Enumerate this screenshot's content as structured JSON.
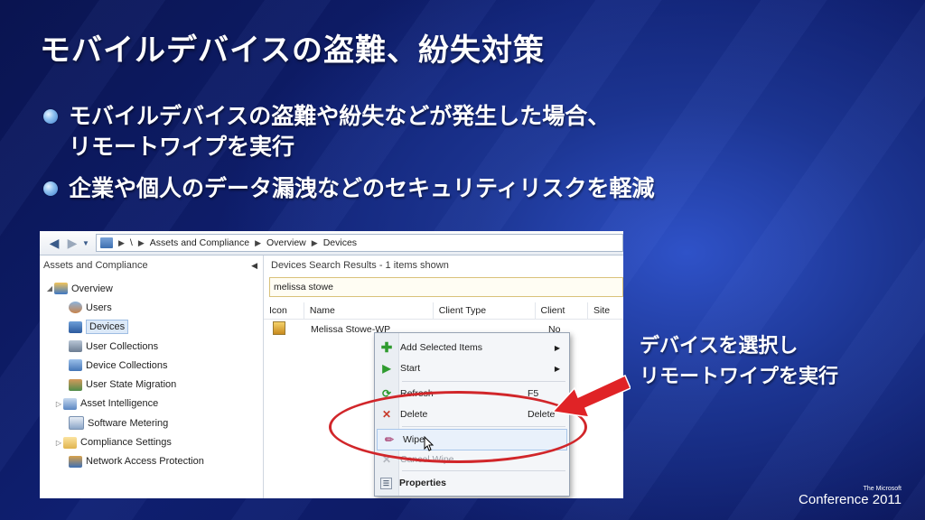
{
  "slide": {
    "title": "モバイルデバイスの盗難、紛失対策",
    "bullets": [
      {
        "line1": "モバイルデバイスの盗難や紛失などが発生した場合、",
        "line2": "リモートワイプを実行"
      },
      {
        "line1": "企業や個人のデータ漏洩などのセキュリティリスクを軽減",
        "line2": ""
      }
    ],
    "callout": {
      "line1": "デバイスを選択し",
      "line2": "リモートワイプを実行"
    },
    "logo": {
      "small": "The Microsoft",
      "main": "Conference 2011"
    },
    "accent_color": "#d1262a"
  },
  "console": {
    "breadcrumb": [
      "\\",
      "Assets and Compliance",
      "Overview",
      "Devices"
    ],
    "left_title": "Assets and Compliance",
    "tree": [
      {
        "label": "Overview",
        "icon": "overview-icon"
      },
      {
        "label": "Users",
        "icon": "users-icon"
      },
      {
        "label": "Devices",
        "icon": "devices-icon",
        "selected": true
      },
      {
        "label": "User Collections",
        "icon": "user-collections-icon"
      },
      {
        "label": "Device Collections",
        "icon": "device-collections-icon"
      },
      {
        "label": "User State Migration",
        "icon": "user-state-migration-icon"
      },
      {
        "label": "Asset Intelligence",
        "icon": "asset-intelligence-icon"
      },
      {
        "label": "Software Metering",
        "icon": "software-metering-icon"
      },
      {
        "label": "Compliance Settings",
        "icon": "folder-icon"
      },
      {
        "label": "Network Access Protection",
        "icon": "network-access-protection-icon"
      }
    ],
    "results_header": "Devices Search Results  -  1 items shown",
    "search_value": "melissa stowe",
    "columns": [
      "Icon",
      "Name",
      "Client Type",
      "Client",
      "Site"
    ],
    "row": {
      "name": "Melissa Stowe-WP",
      "client": "No"
    },
    "context_menu": [
      {
        "label": "Add Selected Items",
        "shortcut": "",
        "submenu": true,
        "icon": "add-icon"
      },
      {
        "label": "Start",
        "shortcut": "",
        "submenu": true,
        "icon": "start-icon"
      },
      {
        "label": "Refresh",
        "shortcut": "F5",
        "icon": "refresh-icon"
      },
      {
        "label": "Delete",
        "shortcut": "Delete",
        "icon": "delete-icon"
      },
      {
        "label": "Wipe",
        "shortcut": "",
        "icon": "wipe-icon"
      },
      {
        "label": "Cancel Wipe",
        "shortcut": "",
        "icon": "cancel-wipe-icon",
        "disabled": true
      },
      {
        "label": "Properties",
        "shortcut": "",
        "icon": "properties-icon",
        "bold": true
      }
    ]
  }
}
